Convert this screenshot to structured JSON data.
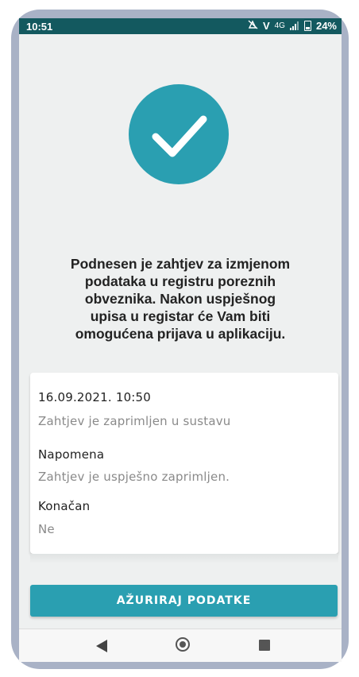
{
  "status_bar": {
    "time": "10:51",
    "vo_lte": "V",
    "network": "4G",
    "battery": "24%"
  },
  "confirmation": {
    "icon": "check-icon",
    "message_lines": [
      "Podnesen je zahtjev za izmjenom",
      "podataka u registru poreznih",
      "obveznika. Nakon uspješnog",
      "upisa u registar će Vam biti",
      "omogućena prijava u aplikaciju."
    ]
  },
  "request_card": {
    "timestamp": "16.09.2021. 10:50",
    "status": "Zahtjev je zaprimljen u sustavu",
    "note_label": "Napomena",
    "note_value": "Zahtjev je uspješno zaprimljen.",
    "final_label": "Konačan",
    "final_value": "Ne"
  },
  "actions": {
    "update_label": "AŽURIRAJ PODATKE"
  },
  "colors": {
    "accent": "#2a9fb1",
    "status_bar": "#13595f"
  }
}
